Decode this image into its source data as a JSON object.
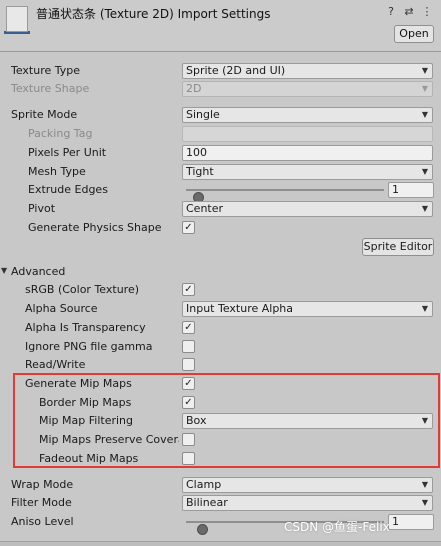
{
  "header": {
    "title": "普通状态条 (Texture 2D) Import Settings",
    "help_icon": "?",
    "preset_icon": "⇄",
    "menu_icon": "⋮",
    "open_label": "Open"
  },
  "texture_type": {
    "label": "Texture Type",
    "value": "Sprite (2D and UI)"
  },
  "texture_shape": {
    "label": "Texture Shape",
    "value": "2D"
  },
  "sprite_mode": {
    "label": "Sprite Mode",
    "value": "Single"
  },
  "packing_tag": {
    "label": "Packing Tag",
    "value": ""
  },
  "pixels_per_unit": {
    "label": "Pixels Per Unit",
    "value": "100"
  },
  "mesh_type": {
    "label": "Mesh Type",
    "value": "Tight"
  },
  "extrude_edges": {
    "label": "Extrude Edges",
    "value": "1",
    "slider_fraction": 0.04
  },
  "pivot": {
    "label": "Pivot",
    "value": "Center"
  },
  "generate_physics_shape": {
    "label": "Generate Physics Shape",
    "checked": true
  },
  "sprite_editor_label": "Sprite Editor",
  "advanced": {
    "label": "Advanced",
    "srgb": {
      "label": "sRGB (Color Texture)",
      "checked": true
    },
    "alpha_source": {
      "label": "Alpha Source",
      "value": "Input Texture Alpha"
    },
    "alpha_is_transparency": {
      "label": "Alpha Is Transparency",
      "checked": true
    },
    "ignore_png_gamma": {
      "label": "Ignore PNG file gamma",
      "checked": false
    },
    "read_write": {
      "label": "Read/Write",
      "checked": false
    },
    "generate_mip_maps": {
      "label": "Generate Mip Maps",
      "checked": true
    },
    "border_mip_maps": {
      "label": "Border Mip Maps",
      "checked": true
    },
    "mip_map_filtering": {
      "label": "Mip Map Filtering",
      "value": "Box"
    },
    "mip_maps_preserve_coverage": {
      "label": "Mip Maps Preserve Covera",
      "checked": false
    },
    "fadeout_mip_maps": {
      "label": "Fadeout Mip Maps",
      "checked": false
    }
  },
  "wrap_mode": {
    "label": "Wrap Mode",
    "value": "Clamp"
  },
  "filter_mode": {
    "label": "Filter Mode",
    "value": "Bilinear"
  },
  "aniso_level": {
    "label": "Aniso Level",
    "value": "1",
    "slider_fraction": 0.06
  },
  "watermark": "CSDN @鱼蛋-Felix",
  "colors": {
    "highlight": "#e53935",
    "panel": "#c8c8c8"
  }
}
